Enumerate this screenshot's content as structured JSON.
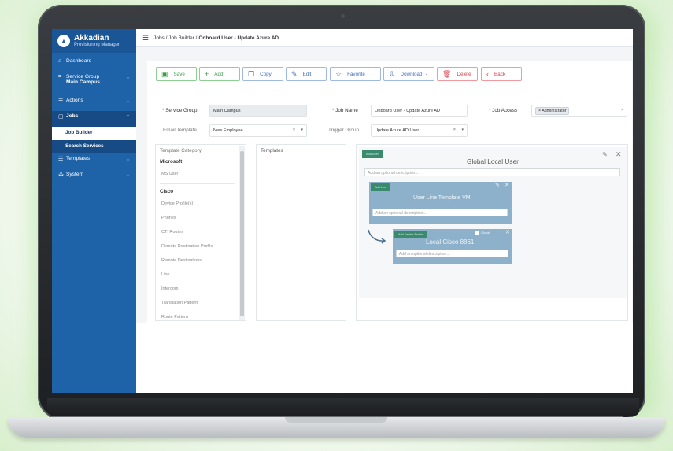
{
  "brand": {
    "name": "Akkadian",
    "sub": "Provisioning Manager"
  },
  "breadcrumb": {
    "prefix": "Jobs / Job Builder / ",
    "current": "Onboard User - Update Azure AD"
  },
  "sidebar": {
    "dashboard": "Dashboard",
    "service_group": "Service Group",
    "service_group_value": "Main Campus",
    "actions": "Actions",
    "jobs": "Jobs",
    "job_builder": "Job Builder",
    "search_services": "Search Services",
    "templates": "Templates",
    "system": "System"
  },
  "toolbar": {
    "save": "Save",
    "add": "Add",
    "copy": "Copy",
    "edit": "Edit",
    "favorite": "Favorite",
    "download": "Download",
    "delete": "Delete",
    "back": "Back"
  },
  "form": {
    "service_group_label": "Service Group",
    "service_group_value": "Main Campus",
    "job_name_label": "Job Name",
    "job_name_value": "Onboard User - Update Azure AD",
    "job_access_label": "Job Access",
    "job_access_chip": "× Administrator",
    "email_template_label": "Email Template",
    "email_template_value": "New Employee",
    "trigger_group_label": "Trigger Group",
    "trigger_group_value": "Update Azure AD User"
  },
  "categories": {
    "header": "Template Category",
    "groups": [
      {
        "name": "Microsoft",
        "items": [
          "MS User"
        ]
      },
      {
        "name": "Cisco",
        "items": [
          "Device Profile(s)",
          "Phones",
          "CTI Routes",
          "Remote Destination Profile",
          "Remote Destinations",
          "Line",
          "Intercom",
          "Translation Pattern",
          "Route Pattern"
        ]
      }
    ]
  },
  "templates": {
    "header": "Templates"
  },
  "canvas": {
    "global_tag": "Add User",
    "global_title": "Global Local User",
    "global_desc": "Add an optional description...",
    "line_tag": "Add Line",
    "line_title": "User Line Template VM",
    "line_desc": "Add an optional description...",
    "dp_tag": "Add Device Profile",
    "dp_title": "Local Cisco 8861",
    "dp_desc": "Add an optional description...",
    "dp_check_label": "Global"
  },
  "colors": {
    "sidebar": "#1e62a8",
    "save": "#3c9a47",
    "delete": "#d6414d",
    "node": "#8eb1cb",
    "tag": "#3a8a6e"
  }
}
